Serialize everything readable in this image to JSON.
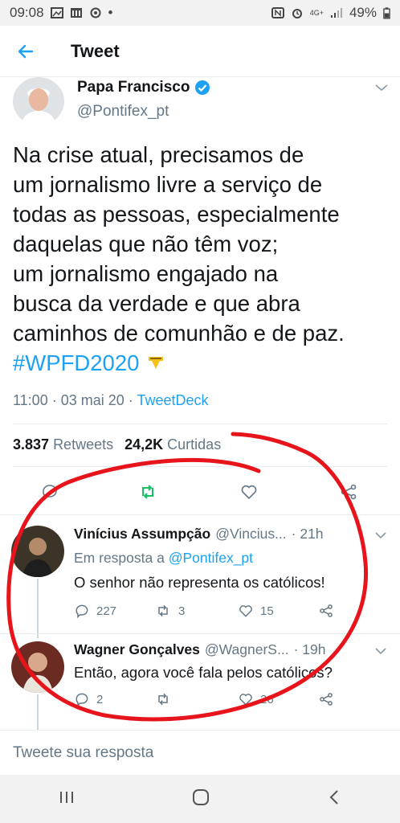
{
  "status_bar": {
    "time": "09:08",
    "battery": "49%",
    "network": "4G+"
  },
  "header": {
    "title": "Tweet"
  },
  "tweet": {
    "author_name": "Papa Francisco",
    "author_handle": "@Pontifex_pt",
    "text_lines": [
      "Na crise atual, precisamos de",
      "um jornalismo livre a serviço de",
      "todas as pessoas, especialmente",
      "daquelas que não têm voz;",
      "um jornalismo engajado na",
      "busca da verdade e que abra",
      "caminhos de comunhão e de paz."
    ],
    "hashtag": "#WPFD2020",
    "timestamp": "11:00 · 03 mai 20 · ",
    "source": "TweetDeck",
    "retweets_count": "3.837",
    "retweets_label": "Retweets",
    "likes_count": "24,2K",
    "likes_label": "Curtidas",
    "accent_color": "#1da1f2",
    "retweet_color": "#17bf63"
  },
  "replies": [
    {
      "name": "Vinícius Assumpção",
      "handle": "@Vincius...",
      "time": "· 21h",
      "reply_to_label": "Em resposta a ",
      "reply_to_handle": "@Pontifex_pt",
      "text": "O senhor não representa os católicos!",
      "reply_count": "227",
      "retweet_count": "3",
      "like_count": "15"
    },
    {
      "name": "Wagner Gonçalves",
      "handle": "@WagnerS...",
      "time": "· 19h",
      "text": "Então, agora você fala pelos católicos?",
      "reply_count": "2",
      "retweet_count": "",
      "like_count": "26"
    }
  ],
  "compose": {
    "placeholder": "Tweete sua resposta"
  },
  "annotation": {
    "color": "#e8141b"
  }
}
